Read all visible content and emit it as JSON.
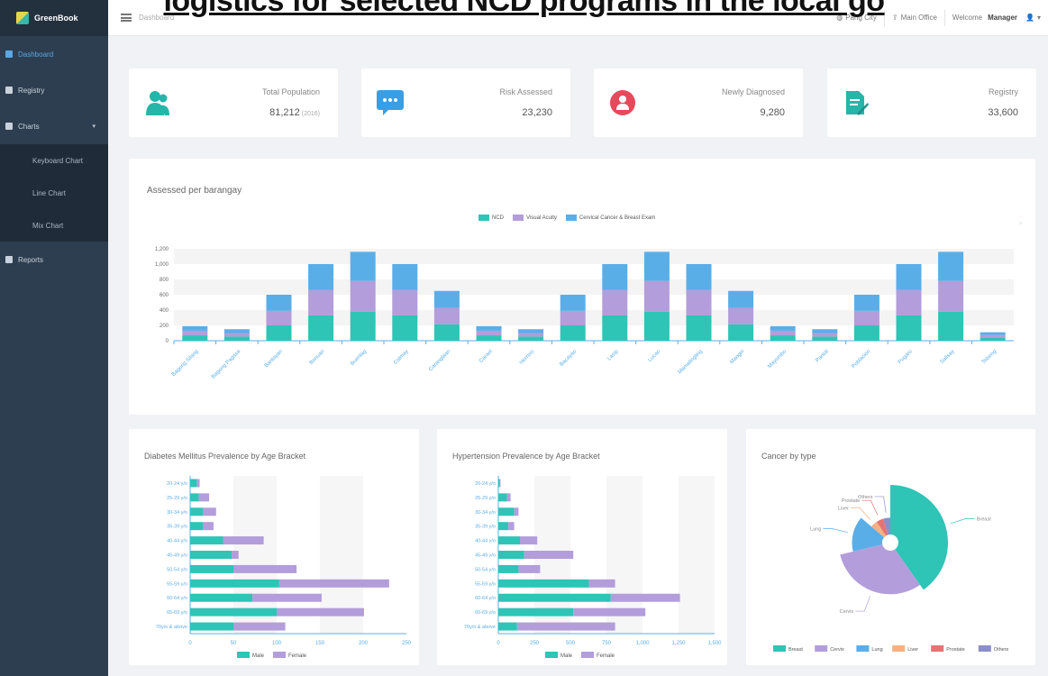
{
  "overlay_title": "logistics for selected NCD programs in the local go",
  "brand": {
    "name": "GreenBook"
  },
  "sidebar": {
    "items": [
      {
        "label": "Dashboard"
      },
      {
        "label": "Registry"
      },
      {
        "label": "Charts"
      },
      {
        "label": "Reports"
      }
    ],
    "chart_submenu": [
      {
        "label": "Keyboard Chart"
      },
      {
        "label": "Line Chart"
      },
      {
        "label": "Mix Chart"
      }
    ]
  },
  "topbar": {
    "breadcrumb": "Dashboard",
    "city": "Pang City",
    "office": "Main Office",
    "welcome": "Welcome",
    "user": "Manager"
  },
  "stats": [
    {
      "label": "Total Population",
      "value": "81,212",
      "unit": "(2016)",
      "icon": "users-icon",
      "color": "#26b5a9"
    },
    {
      "label": "Risk Assessed",
      "value": "23,230",
      "unit": "",
      "icon": "chat-icon",
      "color": "#3a9ee4"
    },
    {
      "label": "Newly Diagnosed",
      "value": "9,280",
      "unit": "",
      "icon": "person-alert-icon",
      "color": "#e8485b"
    },
    {
      "label": "Registry",
      "value": "33,600",
      "unit": "",
      "icon": "document-edit-icon",
      "color": "#26b5a9"
    }
  ],
  "colors": {
    "ncd": "#2ec4b6",
    "visual": "#b39ddb",
    "cervical": "#5aaee8",
    "male": "#2ec4b6",
    "female": "#b39ddb",
    "lung": "#5aaee8",
    "liver": "#f4b183",
    "prostate": "#e57373",
    "others": "#8c8fc9"
  },
  "barangay_chart": {
    "title": "Assessed per barangay",
    "legend": [
      "NCD",
      "Visual Acuity",
      "Cervical Cancer & Breast Exam"
    ],
    "y_ticks": [
      "0",
      "200",
      "400",
      "600",
      "800",
      "1,000",
      "1,200"
    ],
    "categories": [
      "Bagong Silang",
      "Bagong Pagasa",
      "Bantayan",
      "Bonuan",
      "Buenlag",
      "Calmay",
      "Caranglaan",
      "Carael",
      "Herrero",
      "Bacayao",
      "Lasip",
      "Lucao",
      "Mamalingling",
      "Mangin",
      "Mayombo",
      "Pantal",
      "Poblacion",
      "Pugaro",
      "Salisay",
      "Tebeng"
    ]
  },
  "chart_data": [
    {
      "type": "bar",
      "stacked": true,
      "title": "Assessed per barangay",
      "ylim": [
        0,
        1200
      ],
      "categories": [
        "Bagong Silang",
        "Bagong Pagasa",
        "Bantayan",
        "Bonuan",
        "Buenlag",
        "Calmay",
        "Caranglaan",
        "Carael",
        "Herrero",
        "Bacayao",
        "Lasip",
        "Lucao",
        "Mamalingling",
        "Mangin",
        "Mayombo",
        "Pantal",
        "Poblacion",
        "Pugaro",
        "Salisay",
        "Tebeng"
      ],
      "series": [
        {
          "name": "NCD",
          "values": [
            70,
            55,
            200,
            330,
            380,
            330,
            215,
            70,
            55,
            200,
            330,
            380,
            330,
            215,
            70,
            55,
            200,
            330,
            380,
            40
          ]
        },
        {
          "name": "Visual Acuity",
          "values": [
            60,
            45,
            190,
            330,
            400,
            330,
            215,
            60,
            45,
            190,
            330,
            400,
            330,
            215,
            60,
            45,
            190,
            330,
            400,
            35
          ]
        },
        {
          "name": "Cervical Cancer & Breast Exam",
          "values": [
            60,
            50,
            210,
            340,
            380,
            340,
            220,
            60,
            50,
            210,
            340,
            380,
            340,
            220,
            60,
            50,
            210,
            340,
            380,
            35
          ]
        }
      ]
    },
    {
      "type": "bar",
      "orientation": "horizontal",
      "stacked": true,
      "title": "Diabetes Mellitus Prevalence by Age Bracket",
      "xlim": [
        0,
        250
      ],
      "x_ticks": [
        "0",
        "50",
        "100",
        "150",
        "200",
        "250"
      ],
      "categories": [
        "20-24 y/o",
        "25-29 y/o",
        "30-34 y/o",
        "35-39 y/o",
        "40-44 y/o",
        "45-49 y/o",
        "50-54 y/o",
        "55-59 y/o",
        "60-64 y/o",
        "65-69 y/o",
        "70y/o & above"
      ],
      "series": [
        {
          "name": "Male",
          "values": [
            8,
            10,
            15,
            15,
            38,
            48,
            50,
            103,
            72,
            100,
            50
          ]
        },
        {
          "name": "Female",
          "values": [
            3,
            12,
            15,
            12,
            47,
            8,
            73,
            127,
            80,
            101,
            60
          ]
        }
      ]
    },
    {
      "type": "bar",
      "orientation": "horizontal",
      "stacked": true,
      "title": "Hypertension Prevalence by Age Bracket",
      "xlim": [
        0,
        1500
      ],
      "x_ticks": [
        "0",
        "250",
        "500",
        "750",
        "1,000",
        "1,250",
        "1,500"
      ],
      "categories": [
        "20-24 y/o",
        "25-29 y/o",
        "30-34 y/o",
        "35-39 y/o",
        "40-44 y/o",
        "45-49 y/o",
        "50-54 y/o",
        "55-59 y/o",
        "60-64 y/o",
        "65-69 y/o",
        "70y/o & above"
      ],
      "series": [
        {
          "name": "Male",
          "values": [
            10,
            60,
            110,
            70,
            150,
            180,
            140,
            630,
            780,
            520,
            130
          ]
        },
        {
          "name": "Female",
          "values": [
            5,
            25,
            30,
            40,
            120,
            340,
            150,
            180,
            480,
            500,
            680
          ]
        }
      ]
    },
    {
      "type": "pie",
      "variant": "rose",
      "title": "Cancer by type",
      "categories": [
        "Breast",
        "Cervix",
        "Lung",
        "Liver",
        "Prostate",
        "Others"
      ],
      "values": [
        35,
        27,
        13,
        4,
        4,
        4
      ]
    }
  ],
  "bottom_legends": {
    "male": "Male",
    "female": "Female",
    "cancer": [
      "Breast",
      "Cervix",
      "Lung",
      "Liver",
      "Prostate",
      "Others"
    ]
  }
}
